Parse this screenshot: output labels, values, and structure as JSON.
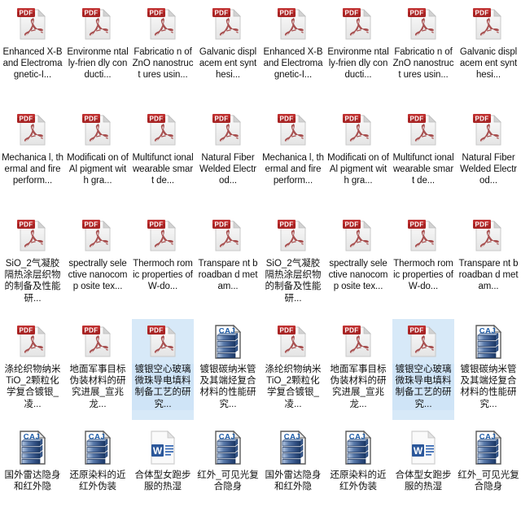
{
  "window": {
    "view": "icon-grid",
    "background_color": "#ffffff",
    "selection_color": "#d7e9f8",
    "columns": 8,
    "rows": 5
  },
  "icons": {
    "pdf": {
      "name": "pdf-file-icon",
      "badge_text": "PDF",
      "badge_color": "#a62626",
      "page_color": "#f2f2f2",
      "glyph_color": "#a34a4a"
    },
    "caj": {
      "name": "caj-file-icon",
      "badge_text": "CAJ",
      "badge_color": "#2b6cb0",
      "page_color": "#ffffff",
      "glyph_color": "#4a6fa5"
    },
    "word": {
      "name": "word-document-icon",
      "badge_text": "W",
      "badge_color": "#2b579a",
      "page_color": "#f6f6f6",
      "glyph_color": "#2b579a"
    }
  },
  "files": [
    {
      "label": "Enhanced X-Band Electroma gnetic-I...",
      "type": "pdf",
      "selected": false,
      "cjk": false
    },
    {
      "label": "Environme ntally-frien dly conducti...",
      "type": "pdf",
      "selected": false,
      "cjk": false
    },
    {
      "label": "Fabricatio n of ZnO nanostruct ures usin...",
      "type": "pdf",
      "selected": false,
      "cjk": false
    },
    {
      "label": "Galvanic displacem ent synthesi...",
      "type": "pdf",
      "selected": false,
      "cjk": false
    },
    {
      "label": "Enhanced X-Band Electroma gnetic-I...",
      "type": "pdf",
      "selected": false,
      "cjk": false
    },
    {
      "label": "Environme ntally-frien dly conducti...",
      "type": "pdf",
      "selected": false,
      "cjk": false
    },
    {
      "label": "Fabricatio n of ZnO nanostruct ures usin...",
      "type": "pdf",
      "selected": false,
      "cjk": false
    },
    {
      "label": "Galvanic displacem ent synthesi...",
      "type": "pdf",
      "selected": false,
      "cjk": false
    },
    {
      "label": "Mechanica l, thermal and fire perform...",
      "type": "pdf",
      "selected": false,
      "cjk": false
    },
    {
      "label": "Modificati on of Al pigment with gra...",
      "type": "pdf",
      "selected": false,
      "cjk": false
    },
    {
      "label": "Multifunct ional wearable smart de...",
      "type": "pdf",
      "selected": false,
      "cjk": false
    },
    {
      "label": "Natural Fiber Welded Electrod...",
      "type": "pdf",
      "selected": false,
      "cjk": false
    },
    {
      "label": "Mechanica l, thermal and fire perform...",
      "type": "pdf",
      "selected": false,
      "cjk": false
    },
    {
      "label": "Modificati on of Al pigment with gra...",
      "type": "pdf",
      "selected": false,
      "cjk": false
    },
    {
      "label": "Multifunct ional wearable smart de...",
      "type": "pdf",
      "selected": false,
      "cjk": false
    },
    {
      "label": "Natural Fiber Welded Electrod...",
      "type": "pdf",
      "selected": false,
      "cjk": false
    },
    {
      "label": "SiO_2气凝胶隔热涂层织物的制备及性能研...",
      "type": "pdf",
      "selected": false,
      "cjk": true
    },
    {
      "label": "spectrally selective nanocomp osite tex...",
      "type": "pdf",
      "selected": false,
      "cjk": false
    },
    {
      "label": "Thermoch romic properties of W-do...",
      "type": "pdf",
      "selected": false,
      "cjk": false
    },
    {
      "label": "Transpare nt broadban d metam...",
      "type": "pdf",
      "selected": false,
      "cjk": false
    },
    {
      "label": "SiO_2气凝胶隔热涂层织物的制备及性能研...",
      "type": "pdf",
      "selected": false,
      "cjk": true
    },
    {
      "label": "spectrally selective nanocomp osite tex...",
      "type": "pdf",
      "selected": false,
      "cjk": false
    },
    {
      "label": "Thermoch romic properties of W-do...",
      "type": "pdf",
      "selected": false,
      "cjk": false
    },
    {
      "label": "Transpare nt broadban d metam...",
      "type": "pdf",
      "selected": false,
      "cjk": false
    },
    {
      "label": "涤纶织物纳米TiO_2颗粒化学复合镀银_凌...",
      "type": "pdf",
      "selected": false,
      "cjk": true
    },
    {
      "label": "地面军事目标伪装材料的研究进展_宣兆龙...",
      "type": "pdf",
      "selected": false,
      "cjk": true
    },
    {
      "label": "镀银空心玻璃微珠导电填料制备工艺的研究...",
      "type": "pdf",
      "selected": true,
      "cjk": true
    },
    {
      "label": "镀银碳纳米管及其端烃复合材料的性能研究...",
      "type": "caj",
      "selected": false,
      "cjk": true
    },
    {
      "label": "涤纶织物纳米TiO_2颗粒化学复合镀银_凌...",
      "type": "pdf",
      "selected": false,
      "cjk": true
    },
    {
      "label": "地面军事目标伪装材料的研究进展_宣兆龙...",
      "type": "pdf",
      "selected": false,
      "cjk": true
    },
    {
      "label": "镀银空心玻璃微珠导电填料制备工艺的研究...",
      "type": "pdf",
      "selected": true,
      "cjk": true
    },
    {
      "label": "镀银碳纳米管及其端烃复合材料的性能研究...",
      "type": "caj",
      "selected": false,
      "cjk": true
    },
    {
      "label": "国外雷达隐身和红外隐",
      "type": "caj",
      "selected": false,
      "cjk": true
    },
    {
      "label": "还原染料的近红外伪装",
      "type": "caj",
      "selected": false,
      "cjk": true
    },
    {
      "label": "合体型女跑步服的热湿",
      "type": "word",
      "selected": false,
      "cjk": true
    },
    {
      "label": "红外_可见光复合隐身",
      "type": "caj",
      "selected": false,
      "cjk": true
    },
    {
      "label": "国外雷达隐身和红外隐",
      "type": "caj",
      "selected": false,
      "cjk": true
    },
    {
      "label": "还原染料的近红外伪装",
      "type": "caj",
      "selected": false,
      "cjk": true
    },
    {
      "label": "合体型女跑步服的热湿",
      "type": "word",
      "selected": false,
      "cjk": true
    },
    {
      "label": "红外_可见光复合隐身",
      "type": "caj",
      "selected": false,
      "cjk": true
    }
  ]
}
